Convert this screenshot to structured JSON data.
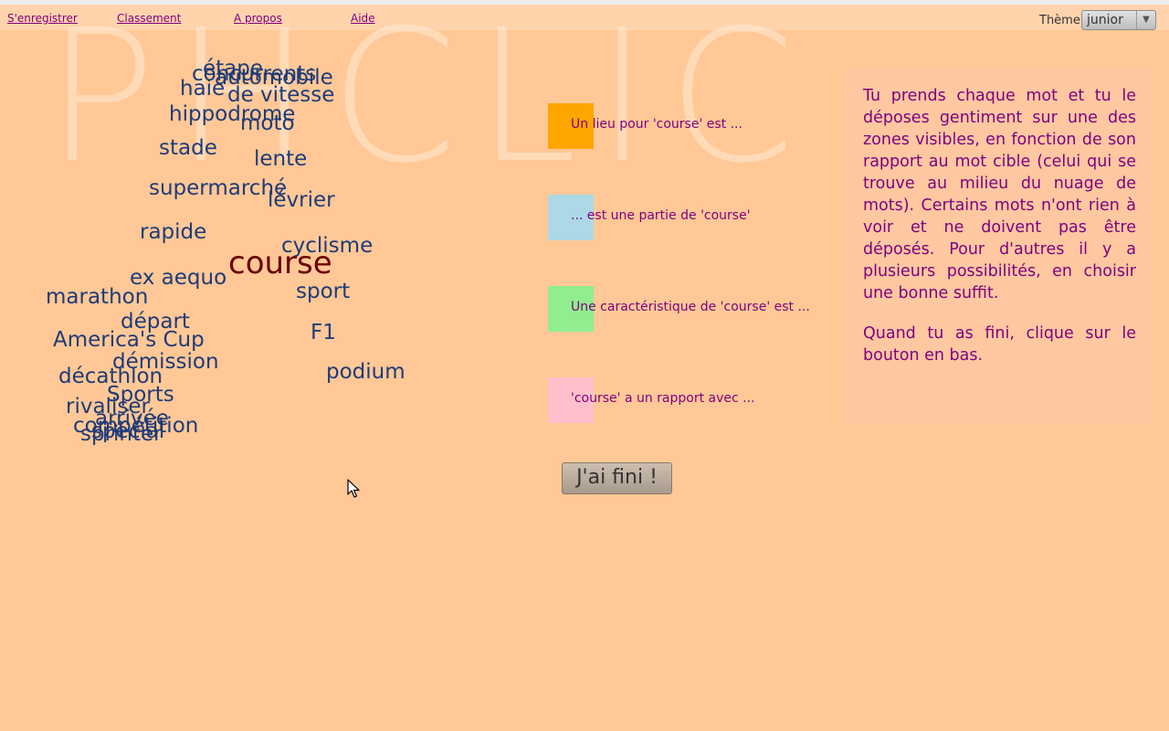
{
  "menu": {
    "items": [
      {
        "label": "S'enregistrer"
      },
      {
        "label": "Classement"
      },
      {
        "label": "A propos"
      },
      {
        "label": "Aide"
      }
    ],
    "theme_label": "Thème",
    "theme_value": "junior"
  },
  "watermark": "PHCLIC",
  "cloud": {
    "target": "course",
    "words": [
      "étape",
      "concurrents",
      "automobile",
      "haie",
      "de vitesse",
      "hippodrome",
      "moto",
      "stade",
      "lente",
      "supermarché",
      "lévrier",
      "rapide",
      "cyclisme",
      "ex aequo",
      "sport",
      "marathon",
      "départ",
      "F1",
      "America's Cup",
      "démission",
      "podium",
      "décathlon",
      "Sports",
      "rivaliser",
      "arrivée",
      "compétition",
      "sprinter",
      "spécial"
    ]
  },
  "zones": [
    {
      "label": "Un lieu pour 'course' est ...",
      "color": "#ffa500"
    },
    {
      "label": "... est une partie de 'course'",
      "color": "#add8e6"
    },
    {
      "label": "Une caractéristique de 'course' est ...",
      "color": "#90ee90"
    },
    {
      "label": "'course' a un rapport avec ...",
      "color": "#ffc0cb"
    }
  ],
  "done_button": "J'ai fini !",
  "instructions": {
    "p1": "Tu prends chaque mot et tu le déposes gentiment sur une des zones visibles, en fonction de son rapport au mot cible (celui qui se trouve au milieu du nuage de mots). Certains mots n'ont rien à voir et ne doivent pas être déposés. Pour d'autres il y a plusieurs possibilités, en choisir une bonne suffit.",
    "p2": "Quand tu as fini, clique sur le bouton en bas."
  }
}
